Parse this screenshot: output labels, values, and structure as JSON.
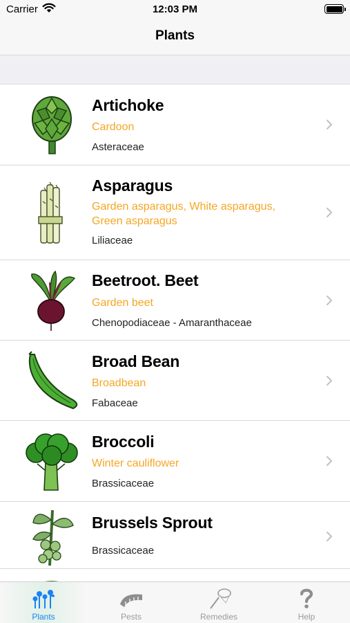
{
  "status_bar": {
    "carrier": "Carrier",
    "time": "12:03 PM"
  },
  "nav": {
    "title": "Plants"
  },
  "plants": [
    {
      "name": "Artichoke",
      "alias": "Cardoon",
      "family": "Asteraceae",
      "icon": "artichoke-icon"
    },
    {
      "name": "Asparagus",
      "alias": "Garden asparagus, White asparagus, Green asparagus",
      "family": "Liliaceae",
      "icon": "asparagus-icon"
    },
    {
      "name": "Beetroot. Beet",
      "alias": "Garden beet",
      "family": "Chenopodiaceae - Amaranthaceae",
      "icon": "beetroot-icon"
    },
    {
      "name": "Broad Bean",
      "alias": "Broadbean",
      "family": "Fabaceae",
      "icon": "broad-bean-icon"
    },
    {
      "name": "Broccoli",
      "alias": "Winter cauliflower",
      "family": "Brassicaceae",
      "icon": "broccoli-icon"
    },
    {
      "name": "Brussels Sprout",
      "alias": "",
      "family": "Brassicaceae",
      "icon": "brussels-sprout-icon"
    }
  ],
  "tabs": [
    {
      "label": "Plants",
      "icon": "plants-icon",
      "active": true
    },
    {
      "label": "Pests",
      "icon": "caterpillar-icon",
      "active": false
    },
    {
      "label": "Remedies",
      "icon": "net-icon",
      "active": false
    },
    {
      "label": "Help",
      "icon": "question-mark-icon",
      "active": false
    }
  ],
  "colors": {
    "alias": "#f5a623",
    "tab_active": "#1a82f7",
    "tab_inactive": "#9a9a9a",
    "background_gap": "#efeff4"
  }
}
